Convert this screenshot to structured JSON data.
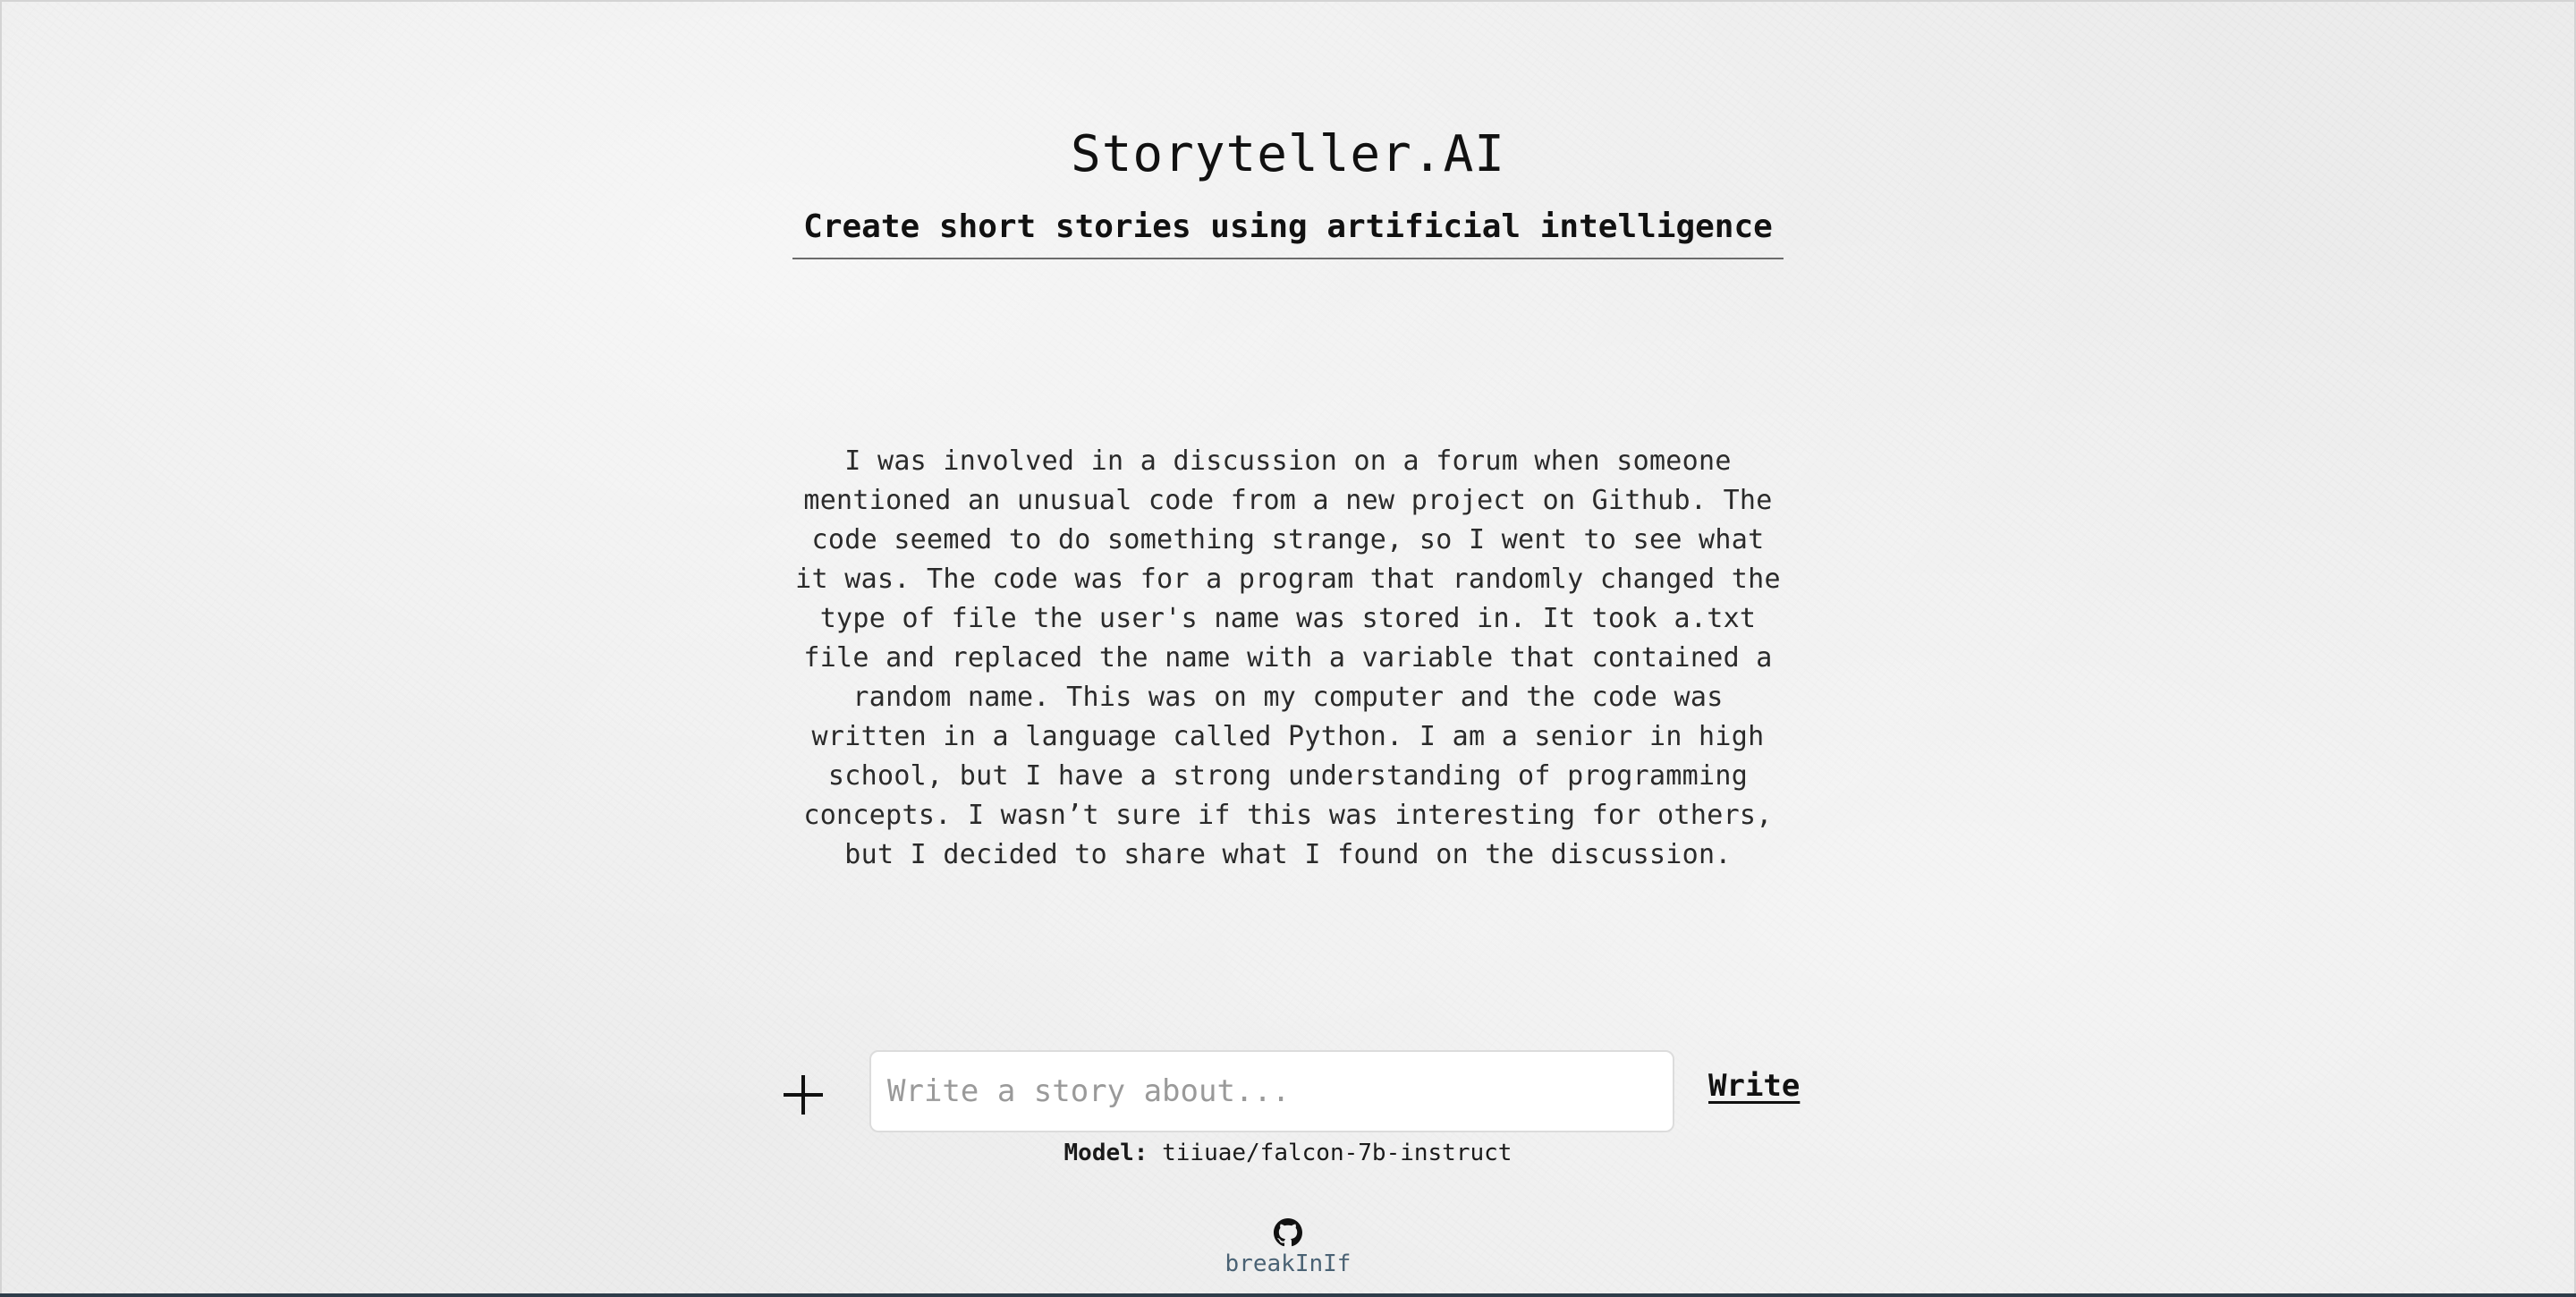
{
  "header": {
    "title": "Storyteller.AI",
    "tagline": "Create short stories using artificial intelligence"
  },
  "story": {
    "text": "I was involved in a discussion on a forum when someone mentioned an unusual code from a new project on Github. The code seemed to do something strange, so I went to see what it was. The code was for a program that randomly changed the type of file the user's name was stored in. It took a.txt file and replaced the name with a variable that contained a random name. This was on my computer and the code was written in a language called Python. I am a senior in high school, but I have a strong understanding of programming concepts. I wasn’t sure if this was interesting for others, but I decided to share what I found on the discussion."
  },
  "compose": {
    "add_icon": "plus-icon",
    "input_value": "",
    "input_placeholder": "Write a story about...",
    "write_label": "Write"
  },
  "model": {
    "label": "Model:",
    "value": "tiiuae/falcon-7b-instruct"
  },
  "footer": {
    "icon": "github-icon",
    "author": "breakInIf"
  }
}
